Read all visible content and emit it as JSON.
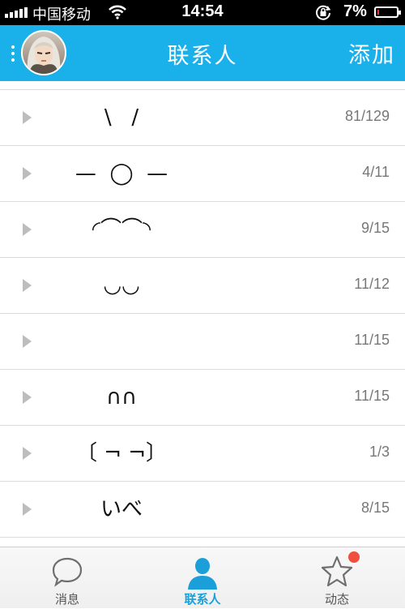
{
  "status_bar": {
    "carrier": "中国移动",
    "time": "14:54",
    "battery_percent": "7%",
    "battery_level": 0.07,
    "battery_color": "#e53b2e",
    "icons": [
      "signal-icon",
      "wifi-icon",
      "rotation-lock-icon",
      "battery-icon"
    ]
  },
  "header": {
    "title": "联系人",
    "add_label": "添加",
    "background": "#1ab0ea"
  },
  "groups": [
    {
      "name": "\\   /",
      "count": "81/129"
    },
    {
      "name": "—  ◯  —",
      "count": "4/11"
    },
    {
      "name": "◜⌒⌒◝",
      "count": "9/15"
    },
    {
      "name": "◡◡",
      "count": "11/12"
    },
    {
      "name": "",
      "count": "11/15"
    },
    {
      "name": "∩∩",
      "count": "11/15"
    },
    {
      "name": "〔 ¬ ¬〕",
      "count": "1/3"
    },
    {
      "name": "いべ",
      "count": "8/15"
    }
  ],
  "tabs": [
    {
      "label": "消息",
      "icon": "chat-bubble-icon",
      "active": false
    },
    {
      "label": "联系人",
      "icon": "person-icon",
      "active": true
    },
    {
      "label": "动态",
      "icon": "star-icon",
      "active": false,
      "has_badge": true
    }
  ],
  "colors": {
    "accent": "#1ab0ea",
    "active_tab": "#1a9fd8",
    "badge": "#f04e3e"
  }
}
